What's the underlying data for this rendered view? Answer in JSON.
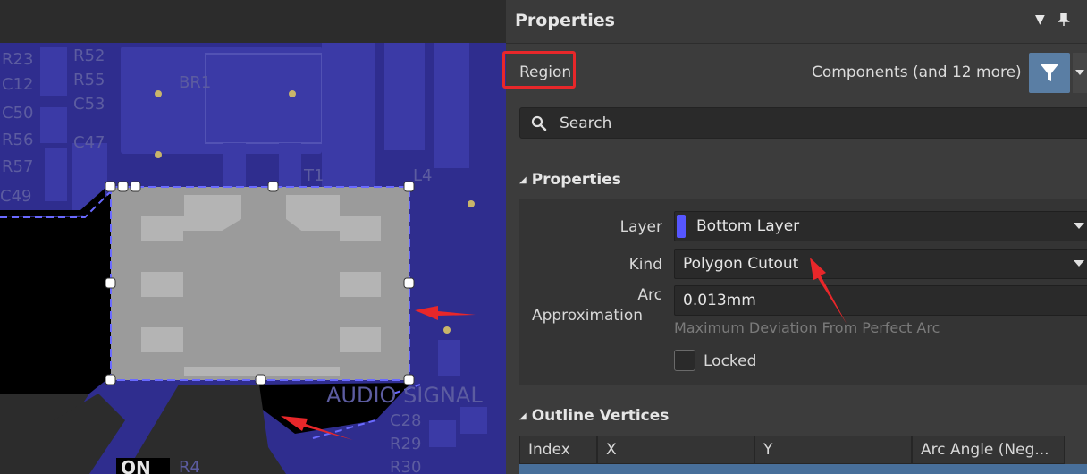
{
  "panel": {
    "title": "Properties",
    "header_buttons": {
      "menu_icon": "triangle-down",
      "pin_icon": "pin"
    },
    "object_type": "Region",
    "filter_label": "Components (and 12 more)",
    "search": {
      "placeholder": "Search"
    },
    "sections": {
      "properties": {
        "title": "Properties",
        "layer": {
          "label": "Layer",
          "value": "Bottom Layer",
          "color": "#5656ff"
        },
        "kind": {
          "label": "Kind",
          "value": "Polygon Cutout"
        },
        "arc_approximation": {
          "label_line1": "Arc",
          "label_line2": "Approximation",
          "value": "0.013mm",
          "hint": "Maximum Deviation From Perfect Arc"
        },
        "locked": {
          "label": "Locked",
          "checked": false
        }
      },
      "outline_vertices": {
        "title": "Outline Vertices",
        "columns": [
          "Index",
          "X",
          "Y",
          "Arc Angle (Neg..."
        ]
      }
    }
  },
  "pcb": {
    "silkscreen_labels": [
      "R52",
      "R23",
      "C12",
      "C50",
      "R56",
      "C47",
      "R57",
      "C49",
      "BR1",
      "R55",
      "C53",
      "T1",
      "L4",
      "AUDIO SIGNAL",
      "C28",
      "R29",
      "R30",
      "ON",
      "R4"
    ],
    "colors": {
      "board": "#2f2d8e",
      "copper": "#3a3aa0",
      "selection": "#9b9b9b",
      "cutout": "#000000"
    }
  },
  "annotations": {
    "highlight_color": "#e8272a"
  }
}
